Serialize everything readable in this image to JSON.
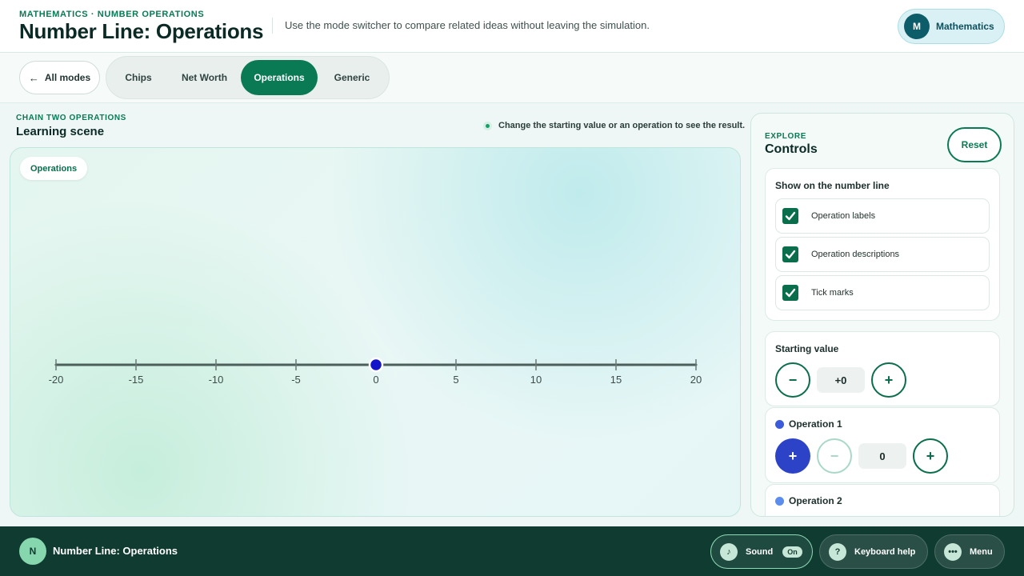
{
  "header": {
    "eyebrow": "MATHEMATICS · NUMBER OPERATIONS",
    "title": "Number Line: Operations",
    "description": "Use the mode switcher to compare related ideas without leaving the simulation.",
    "subject": {
      "avatar_letter": "M",
      "label": "Mathematics"
    }
  },
  "modebar": {
    "all_modes_label": "All modes",
    "tabs": [
      {
        "label": "Chips",
        "active": false
      },
      {
        "label": "Net Worth",
        "active": false
      },
      {
        "label": "Operations",
        "active": true
      },
      {
        "label": "Generic",
        "active": false
      }
    ]
  },
  "scene": {
    "eyebrow": "CHAIN TWO OPERATIONS",
    "title": "Learning scene",
    "hint": "Change the starting value or an operation to see the result.",
    "chip_label": "Operations",
    "number_line": {
      "ticks": [
        -20,
        -15,
        -10,
        -5,
        0,
        5,
        10,
        15,
        20
      ],
      "min": -20,
      "max": 20,
      "marker_value": 0,
      "marker_color": "#1414c8"
    }
  },
  "controls": {
    "eyebrow": "EXPLORE",
    "title": "Controls",
    "reset_label": "Reset",
    "show": {
      "title": "Show on the number line",
      "options": [
        {
          "label": "Operation labels",
          "checked": true
        },
        {
          "label": "Operation descriptions",
          "checked": true
        },
        {
          "label": "Tick marks",
          "checked": true
        }
      ]
    },
    "starting_value": {
      "title": "Starting value",
      "minus": "−",
      "value": "+0",
      "plus": "+"
    },
    "operation1": {
      "title": "Operation 1",
      "dot_color": "#3b5bdb",
      "add": "+",
      "subtract": "−",
      "value": "0",
      "plus": "+"
    },
    "operation2": {
      "title": "Operation 2",
      "dot_color": "#5b8def"
    }
  },
  "footer": {
    "app_letter": "N",
    "app_name": "Number Line: Operations",
    "sound_label": "Sound",
    "sound_state": "On",
    "keyboard_label": "Keyboard help",
    "menu_label": "Menu",
    "sound_icon": "♪",
    "keyboard_icon": "?",
    "menu_icon": "•••"
  },
  "colors": {
    "accent": "#0a7a55",
    "footer_bg": "#0f3b30",
    "op1_button": "#2d43c7"
  }
}
